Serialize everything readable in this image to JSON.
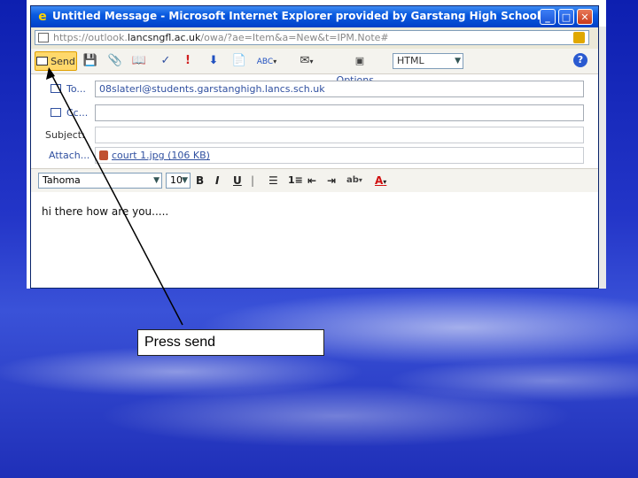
{
  "window": {
    "title": "Untitled Message - Microsoft Internet Explorer provided by Garstang High School",
    "url_prefix": "https://outlook.",
    "url_host": "lancsngfl.ac.uk",
    "url_rest": "/owa/?ae=Item&a=New&t=IPM.Note#"
  },
  "toolbar": {
    "send_label": "Send",
    "options_label": "Options...",
    "format_value": "HTML"
  },
  "message": {
    "to_label": "To...",
    "to_value": "08slaterl@students.garstanghigh.lancs.sch.uk",
    "cc_label": "Cc...",
    "cc_value": "",
    "subject_label": "Subject:",
    "subject_value": "",
    "attach_label": "Attach...",
    "attach_value": "court 1.jpg (106 KB)"
  },
  "format": {
    "font_name": "Tahoma",
    "font_size": "10",
    "bold": "B",
    "italic": "I",
    "underline": "U"
  },
  "body_text": "hi there how are you.....",
  "callout_text": "Press send"
}
